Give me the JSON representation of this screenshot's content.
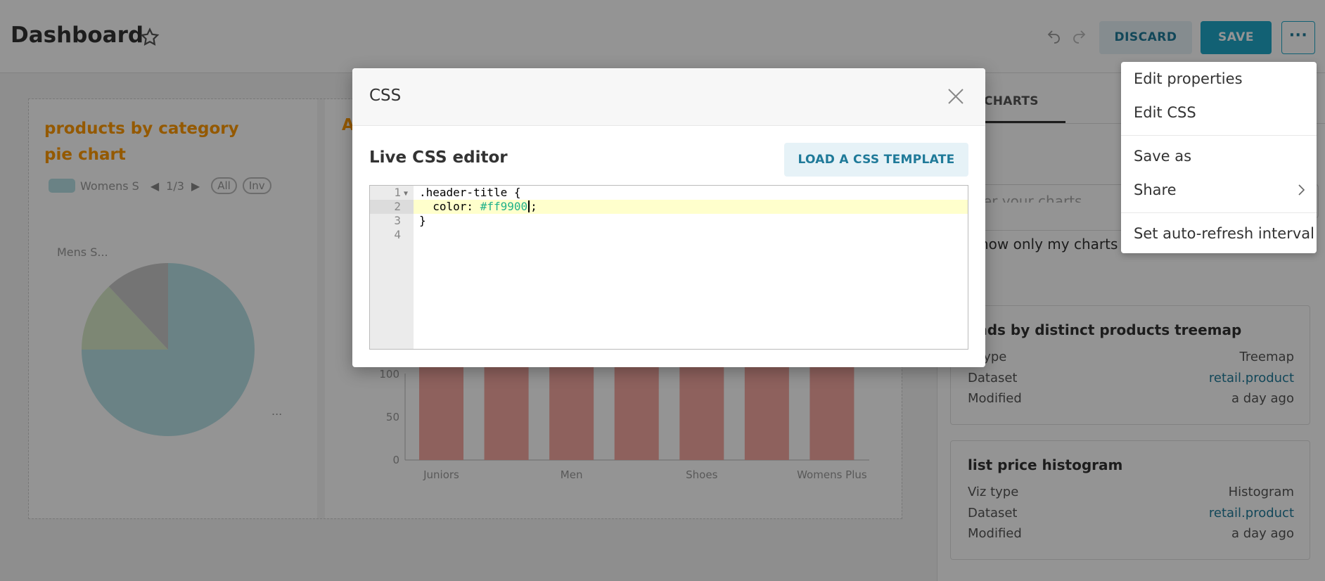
{
  "header": {
    "title": "Dashboard",
    "discard_label": "DISCARD",
    "save_label": "SAVE",
    "more_label": "···"
  },
  "pie_chart": {
    "title": "products by category pie chart",
    "legend_label": "Womens S",
    "legend_page": "1/3",
    "pill_all": "All",
    "pill_inv": "Inv",
    "side_label": "Mens S...",
    "more_label": "..."
  },
  "bar_chart": {
    "title_fragment": "A"
  },
  "chart_data": {
    "type": "bar",
    "categories": [
      "Juniors",
      "",
      "Men",
      "",
      "Shoes",
      "",
      "Womens Plus"
    ],
    "values": [
      140,
      140,
      140,
      140,
      140,
      140,
      140
    ],
    "y_ticks": [
      "0",
      "50",
      "100"
    ],
    "ylim": [
      0,
      140
    ],
    "color": "#f4a7a0"
  },
  "pie_data": {
    "type": "pie",
    "values": [
      75,
      13,
      12
    ],
    "colors": [
      "#b7e0e6",
      "#d8e8c8",
      "#c8c8c8"
    ]
  },
  "sidebar": {
    "tab_label": "CHARTS",
    "filter_placeholder": "ter your charts",
    "only_mine_label": "how only my charts",
    "cards": [
      {
        "title": "ands by distinct products treemap",
        "viz_label": "z type",
        "viz_value": "Treemap",
        "dataset_label": "Dataset",
        "dataset_value": "retail.product",
        "modified_label": "Modified",
        "modified_value": "a day ago"
      },
      {
        "title": "list price histogram",
        "viz_label": "Viz type",
        "viz_value": "Histogram",
        "dataset_label": "Dataset",
        "dataset_value": "retail.product",
        "modified_label": "Modified",
        "modified_value": "a day ago"
      }
    ]
  },
  "menu": {
    "items": [
      "Edit properties",
      "Edit CSS",
      "Save as",
      "Share",
      "Set auto-refresh interval"
    ]
  },
  "modal": {
    "title": "CSS",
    "editor_label": "Live CSS editor",
    "load_template_label": "LOAD A CSS TEMPLATE",
    "line_numbers": [
      "1",
      "2",
      "3",
      "4"
    ],
    "code_line1": ".header-title {",
    "code_line2_prop": "  color: ",
    "code_line2_value": "#ff9900",
    "code_line2_end": ";",
    "code_line3": "}"
  },
  "colors": {
    "accent": "#20a7c9",
    "title_orange": "#ff9900",
    "link": "#1f7a99"
  }
}
